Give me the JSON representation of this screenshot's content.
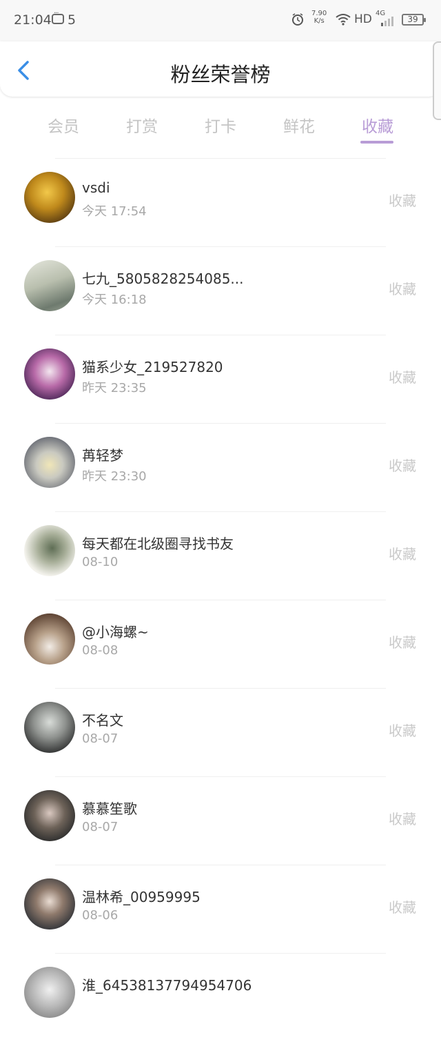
{
  "status_bar": {
    "time": "21:04",
    "notification_count": "5",
    "net_speed_value": "7.90",
    "net_speed_unit": "K/s",
    "hd": "HD",
    "network": "4G",
    "battery": "39"
  },
  "header": {
    "title": "粉丝荣誉榜"
  },
  "tabs": [
    {
      "label": "会员"
    },
    {
      "label": "打赏"
    },
    {
      "label": "打卡"
    },
    {
      "label": "鲜花"
    },
    {
      "label": "收藏"
    }
  ],
  "active_tab": "收藏",
  "colors": {
    "accent": "#b89cd6",
    "back_arrow": "#3a8ee6"
  },
  "list": [
    {
      "name": "vsdi",
      "time": "今天 17:54",
      "tag": "收藏"
    },
    {
      "name": "七九_5805828254085...",
      "time": "今天 16:18",
      "tag": "收藏"
    },
    {
      "name": "猫系少女_219527820",
      "time": "昨天 23:35",
      "tag": "收藏"
    },
    {
      "name": "苒轻梦",
      "time": "昨天 23:30",
      "tag": "收藏"
    },
    {
      "name": "每天都在北级圈寻找书友",
      "time": "08-10",
      "tag": "收藏"
    },
    {
      "name": "@小海螺~",
      "time": "08-08",
      "tag": "收藏"
    },
    {
      "name": "不名文",
      "time": "08-07",
      "tag": "收藏"
    },
    {
      "name": "慕慕笙歌",
      "time": "08-07",
      "tag": "收藏"
    },
    {
      "name": "温林希_00959995",
      "time": "08-06",
      "tag": "收藏"
    },
    {
      "name": "淮_64538137794954706",
      "time": "",
      "tag": ""
    }
  ]
}
